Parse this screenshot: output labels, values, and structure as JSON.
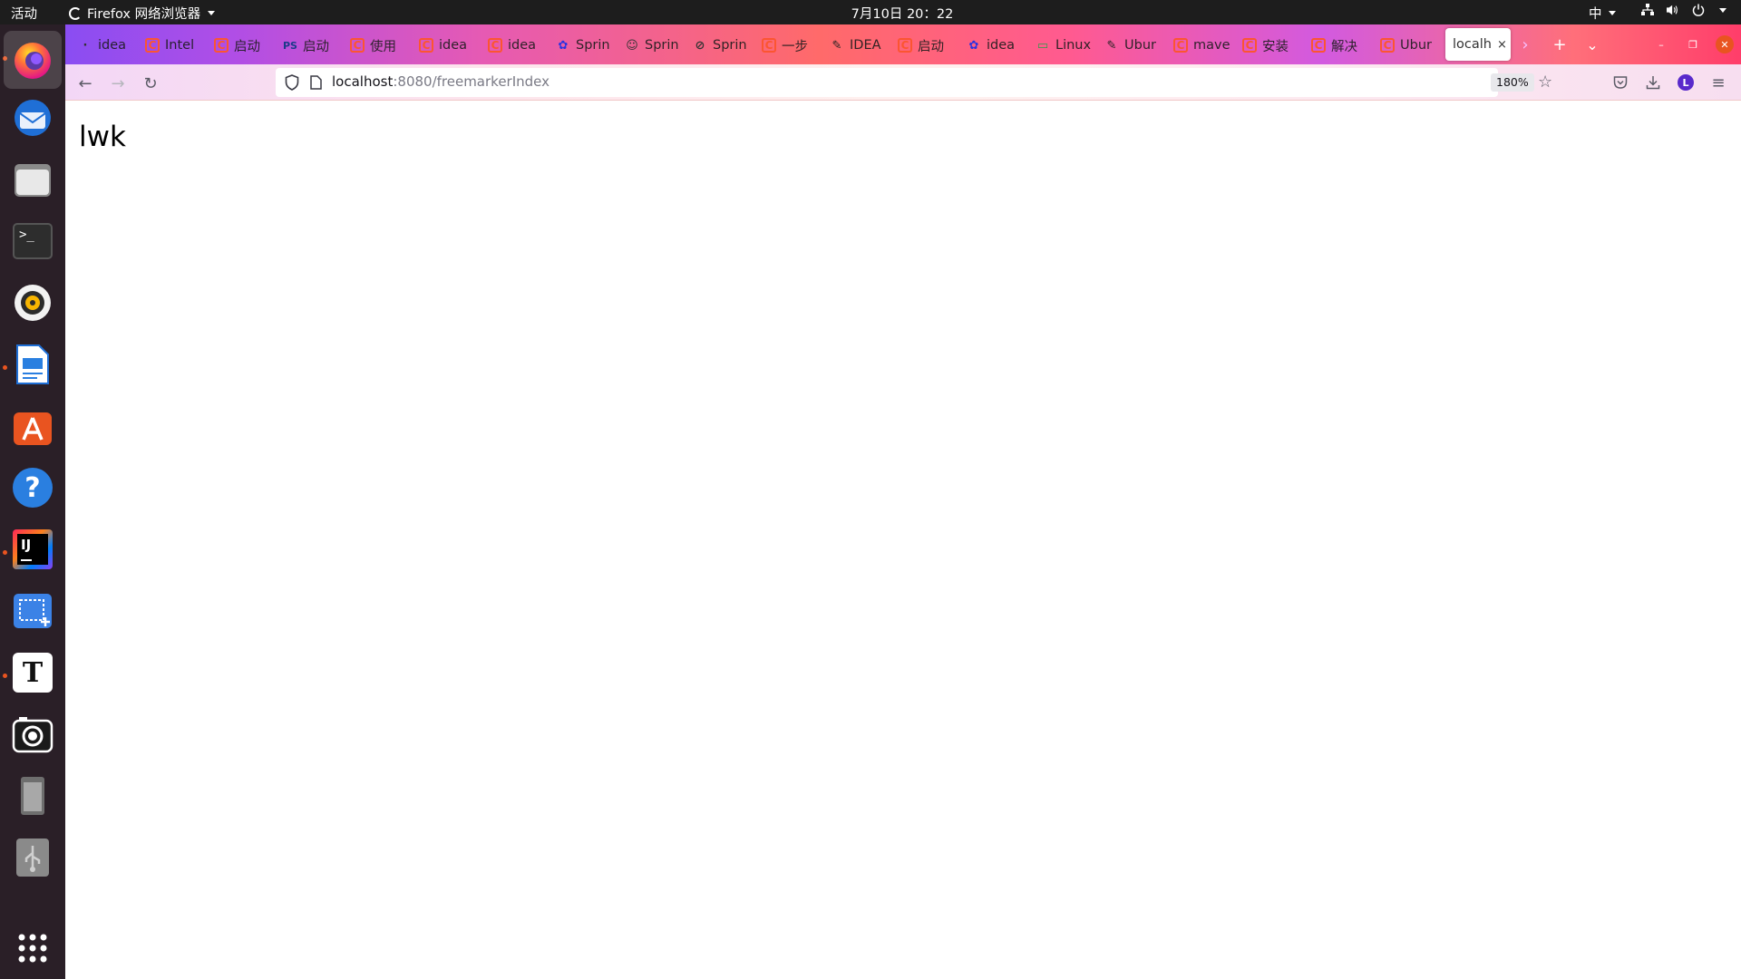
{
  "topbar": {
    "activities": "活动",
    "app_name": "Firefox 网络浏览器",
    "clock": "7月10日 20：22",
    "input_method": "中"
  },
  "dock": {
    "items": [
      {
        "name": "firefox",
        "active": true
      },
      {
        "name": "thunderbird"
      },
      {
        "name": "files"
      },
      {
        "name": "terminal"
      },
      {
        "name": "rhythmbox"
      },
      {
        "name": "libreoffice-writer"
      },
      {
        "name": "ubuntu-software"
      },
      {
        "name": "help"
      },
      {
        "name": "intellij-idea"
      },
      {
        "name": "screenshot-area"
      },
      {
        "name": "text-editor"
      },
      {
        "name": "camera"
      },
      {
        "name": "removable-drive"
      },
      {
        "name": "usb-drive"
      },
      {
        "name": "show-applications"
      }
    ],
    "terminal_glyph": ">_",
    "idea_glyph": "IJ",
    "text_glyph": "T",
    "help_glyph": "?"
  },
  "tabs": [
    {
      "icon": "idea-icon",
      "title": "idea"
    },
    {
      "icon": "csdn-icon",
      "title": "Intel"
    },
    {
      "icon": "csdn-icon",
      "title": "启动"
    },
    {
      "icon": "ps-icon",
      "title": "启动"
    },
    {
      "icon": "csdn-icon",
      "title": "使用"
    },
    {
      "icon": "csdn-icon",
      "title": "idea"
    },
    {
      "icon": "csdn-icon",
      "title": "idea"
    },
    {
      "icon": "baidu-icon",
      "title": "Sprin"
    },
    {
      "icon": "emoji-icon",
      "title": "Sprin"
    },
    {
      "icon": "compass-icon",
      "title": "Sprin"
    },
    {
      "icon": "csdn-icon",
      "title": "一步"
    },
    {
      "icon": "pen-icon",
      "title": "IDEA"
    },
    {
      "icon": "csdn-icon",
      "title": "启动"
    },
    {
      "icon": "baidu-icon",
      "title": "idea"
    },
    {
      "icon": "linux-icon",
      "title": "Linux"
    },
    {
      "icon": "pen-icon",
      "title": "Ubur"
    },
    {
      "icon": "csdn-icon",
      "title": "mave"
    },
    {
      "icon": "csdn-icon",
      "title": "安装"
    },
    {
      "icon": "csdn-icon",
      "title": "解决"
    },
    {
      "icon": "csdn-icon",
      "title": "Ubur"
    }
  ],
  "current_tab": {
    "title": "localh",
    "close": "×"
  },
  "tab_controls": {
    "scroll_right": "›",
    "new_tab": "+",
    "list_all": "⌄"
  },
  "window_controls": {
    "minimize": "–",
    "restore": "❐",
    "close": "✕"
  },
  "navbar": {
    "back": "←",
    "forward": "→",
    "reload": "↻",
    "url_host": "localhost",
    "url_rest": ":8080/freemarkerIndex",
    "zoom": "180%",
    "bookmark_star": "☆",
    "account_letter": "L",
    "menu": "≡"
  },
  "page": {
    "text": "lwk"
  },
  "colors": {
    "topbar": "#1d1d1d",
    "dock": "#2a1f27",
    "ubuntu_orange": "#e95420",
    "csdn_red": "#fc5531"
  }
}
